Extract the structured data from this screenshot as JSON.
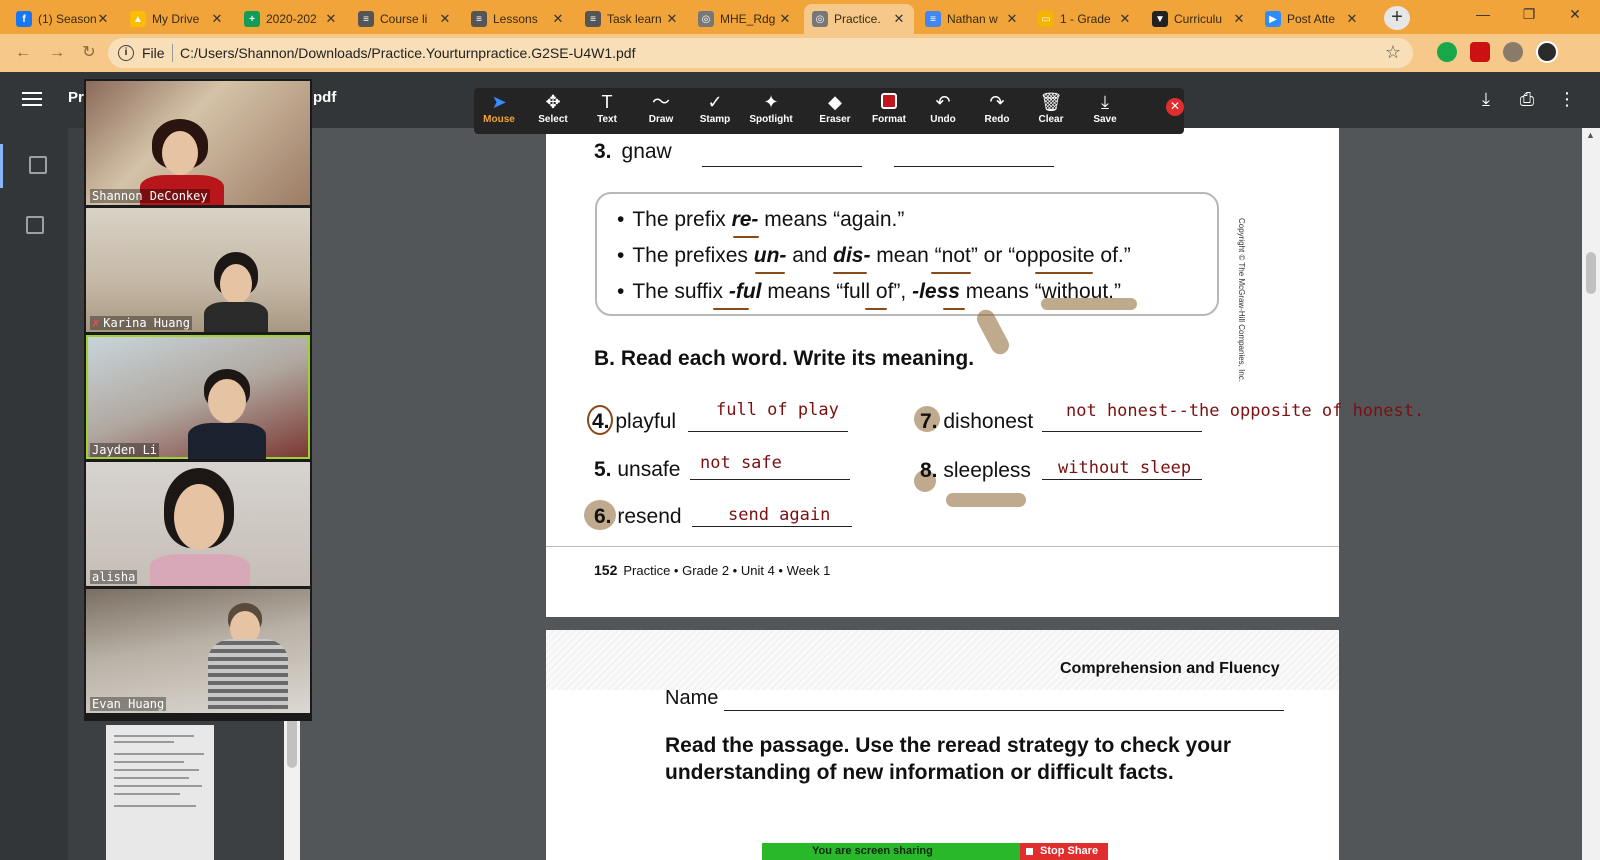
{
  "browser": {
    "tabs": [
      {
        "title": "(1) Season",
        "icon": "facebook-icon",
        "color": "#1877f2",
        "glyph": "f"
      },
      {
        "title": "My Drive",
        "icon": "google-drive-icon",
        "color": "#fbbc04",
        "glyph": "▲"
      },
      {
        "title": "2020-202",
        "icon": "google-sheets-icon",
        "color": "#0f9d58",
        "glyph": "+"
      },
      {
        "title": "Course li",
        "icon": "doc-icon",
        "color": "#555555",
        "glyph": "≡"
      },
      {
        "title": "Lessons",
        "icon": "doc-icon",
        "color": "#555555",
        "glyph": "≡"
      },
      {
        "title": "Task learn",
        "icon": "doc-icon",
        "color": "#555555",
        "glyph": "≡"
      },
      {
        "title": "MHE_Rdg",
        "icon": "globe-icon",
        "color": "#777777",
        "glyph": "◎"
      },
      {
        "title": "Practice.",
        "icon": "globe-icon",
        "color": "#777777",
        "glyph": "◎"
      },
      {
        "title": "Nathan w",
        "icon": "google-docs-icon",
        "color": "#4285f4",
        "glyph": "≡"
      },
      {
        "title": "1 - Grade",
        "icon": "google-slides-icon",
        "color": "#f4b400",
        "glyph": "▭"
      },
      {
        "title": "Curriculu",
        "icon": "shield-icon",
        "color": "#222222",
        "glyph": "▼"
      },
      {
        "title": "Post Atte",
        "icon": "zoom-icon",
        "color": "#2d8cff",
        "glyph": "▶"
      }
    ],
    "active_tab": 7,
    "new_tab": "+",
    "address": {
      "scheme_label": "File",
      "url": "C:/Users/Shannon/Downloads/Practice.Yourturnpractice.G2SE-U4W1.pdf"
    }
  },
  "pdf_viewer": {
    "title_left": "Pr",
    "title_right": "pdf"
  },
  "participants": [
    {
      "name": "Shannon DeConkey",
      "muted": false,
      "active": false
    },
    {
      "name": "Karina Huang",
      "muted": true,
      "active": false
    },
    {
      "name": "Jayden Li",
      "muted": false,
      "active": true
    },
    {
      "name": "alisha",
      "muted": false,
      "active": false
    },
    {
      "name": "Evan Huang",
      "muted": false,
      "active": false
    }
  ],
  "annotation_toolbar": {
    "tools": [
      {
        "label": "Mouse",
        "icon": "mouse-pointer-icon",
        "glyph": "➤"
      },
      {
        "label": "Select",
        "icon": "move-icon",
        "glyph": "✥"
      },
      {
        "label": "Text",
        "icon": "text-icon",
        "glyph": "T"
      },
      {
        "label": "Draw",
        "icon": "draw-icon",
        "glyph": "〜"
      },
      {
        "label": "Stamp",
        "icon": "stamp-icon",
        "glyph": "✓"
      },
      {
        "label": "Spotlight",
        "icon": "spotlight-icon",
        "glyph": "✦"
      },
      {
        "label": "Eraser",
        "icon": "eraser-icon",
        "glyph": "◆"
      },
      {
        "label": "Format",
        "icon": "format-icon",
        "glyph": ""
      },
      {
        "label": "Undo",
        "icon": "undo-icon",
        "glyph": "↶"
      },
      {
        "label": "Redo",
        "icon": "redo-icon",
        "glyph": "↷"
      },
      {
        "label": "Clear",
        "icon": "trash-icon",
        "glyph": "🗑"
      },
      {
        "label": "Save",
        "icon": "save-icon",
        "glyph": "⤓"
      }
    ],
    "selected": 0,
    "format_color": "#c0161d"
  },
  "page1": {
    "q3": {
      "num": "3.",
      "word": "gnaw"
    },
    "rules": [
      {
        "pre": "The prefix ",
        "affix": "re-",
        "post": " means “again.”"
      },
      {
        "pre": "The prefixes ",
        "affix": "un-",
        "mid": " and ",
        "affix2": "dis-",
        "post": " mean “not” or “opposite of.”"
      },
      {
        "pre": "The suffix ",
        "affix": "-ful",
        "post": " means “full of”, ",
        "affix2": "-less",
        "post2": " means “without.”"
      }
    ],
    "section_b": "B. Read each word. Write its meaning.",
    "items": [
      {
        "num": "4.",
        "word": "playful",
        "answer": "full of play"
      },
      {
        "num": "5.",
        "word": "unsafe",
        "answer": "not safe"
      },
      {
        "num": "6.",
        "word": "resend",
        "answer": "send again"
      },
      {
        "num": "7.",
        "word": "dishonest",
        "answer": "not honest--the opposite of honest."
      },
      {
        "num": "8.",
        "word": "sleepless",
        "answer": "without sleep"
      }
    ],
    "footer": {
      "page": "152",
      "text": "Practice • Grade 2 • Unit 4 • Week 1"
    },
    "copyright": "Copyright © The McGraw-Hill Companies, Inc."
  },
  "page2": {
    "section": "Comprehension and Fluency",
    "name_label": "Name",
    "instructions": "Read the passage. Use the reread strategy to check your understanding of new information or difficult facts."
  },
  "share_banner": {
    "status": "You are screen sharing",
    "stop": "Stop Share"
  }
}
